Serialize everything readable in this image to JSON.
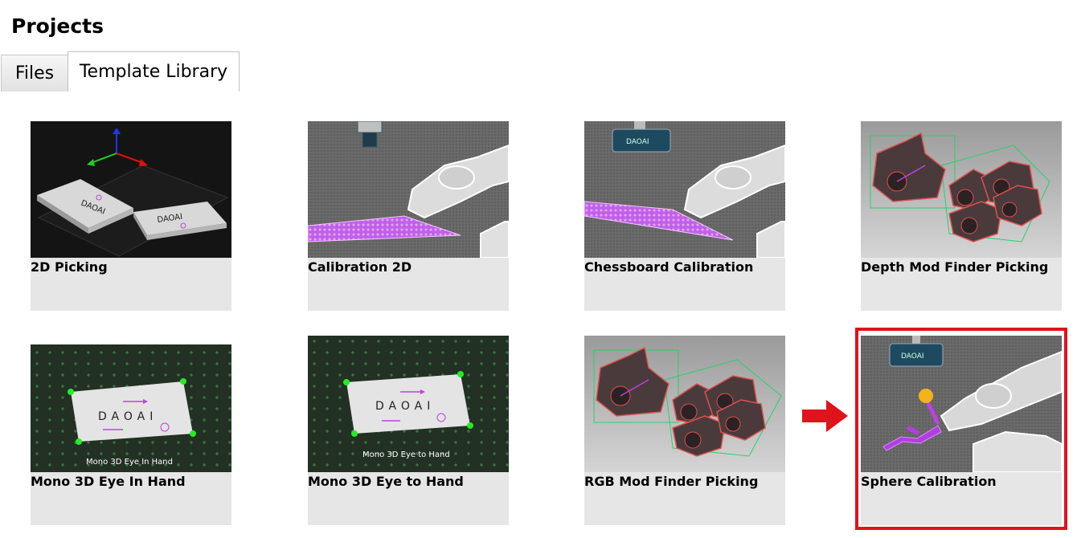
{
  "page": {
    "title": "Projects"
  },
  "tabs": [
    {
      "label": "Files"
    },
    {
      "label": "Template Library",
      "selected": true
    }
  ],
  "templates": [
    {
      "label": "2D Picking"
    },
    {
      "label": "Calibration 2D"
    },
    {
      "label": "Chessboard Calibration"
    },
    {
      "label": "Depth Mod Finder Picking"
    },
    {
      "label": "Mono 3D Eye In Hand",
      "caption": "Mono 3D Eye In Hand"
    },
    {
      "label": "Mono 3D Eye to Hand",
      "caption": "Mono 3D Eye to Hand"
    },
    {
      "label": "RGB Mod Finder Picking"
    },
    {
      "label": "Sphere Calibration",
      "highlighted": true
    }
  ],
  "brand": {
    "logo_text": "DAOAI"
  },
  "colors": {
    "highlight": "#e0121b",
    "accent_magenta": "#c040e0",
    "marker_green": "#22dd22"
  }
}
